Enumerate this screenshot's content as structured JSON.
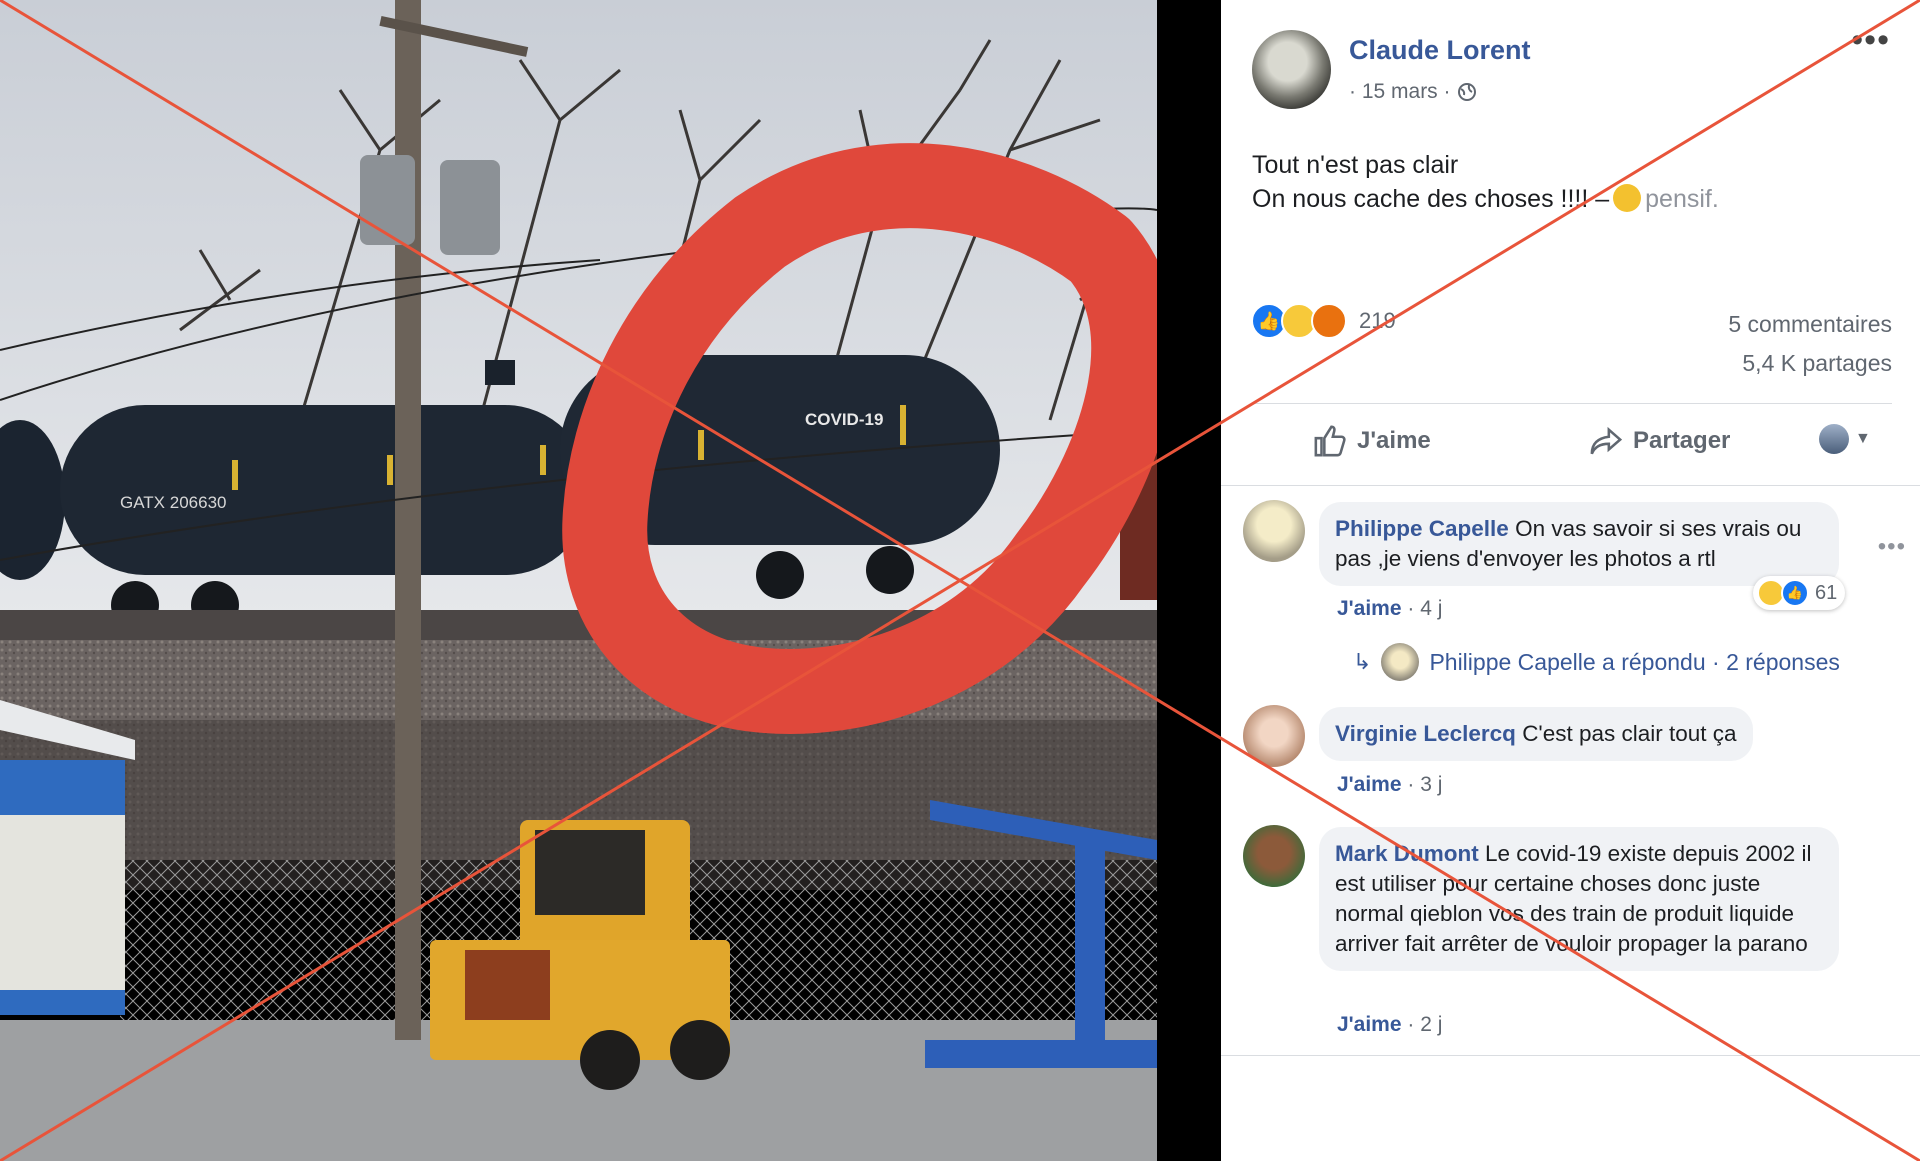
{
  "photo": {
    "tanker_left_text": "GATX 206630",
    "tanker_right_text": "COVID-19"
  },
  "post": {
    "author": "Claude Lorent",
    "date": "· 15 mars ·",
    "text_line1": "Tout n'est pas clair",
    "text_line2": "On nous cache des choses !!!! –",
    "mood": "pensif.",
    "reactions_count": "219",
    "comments_count": "5 commentaires",
    "shares_count": "5,4 K partages"
  },
  "actions": {
    "like": "J'aime",
    "share": "Partager"
  },
  "comments": [
    {
      "name": "Philippe Capelle",
      "text": "On vas savoir si ses vrais ou pas ,je viens d'envoyer les photos a rtl",
      "like_label": "J'aime",
      "age": "· 4 j",
      "reactions": "61"
    },
    {
      "name": "Virginie Leclercq",
      "text": "C'est pas clair tout ça",
      "like_label": "J'aime",
      "age": "· 3 j"
    },
    {
      "name": "Mark Dumont",
      "text": "Le covid-19 existe depuis 2002 il est utiliser pour certaine choses donc juste normal qieblon vos des train de produit liquide arriver fait arrêter de vouloir propager la parano",
      "like_label": "J'aime",
      "age": "· 2 j"
    }
  ],
  "reply": {
    "text": "Philippe Capelle a répondu · 2 réponses"
  },
  "colors": {
    "link": "#385898",
    "like_blue": "#1877f2",
    "cross_red": "#e8543a",
    "circle_red": "#e0483b"
  }
}
